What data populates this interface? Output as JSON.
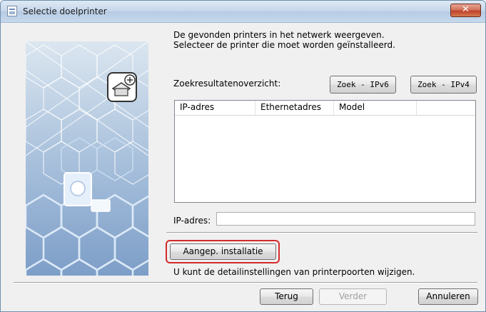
{
  "window": {
    "title": "Selectie doelprinter",
    "close_label": "✕"
  },
  "intro": {
    "line1": "De gevonden printers in het netwerk weergeven.",
    "line2": "Selecteer de printer die moet worden geïnstalleerd."
  },
  "search": {
    "label": "Zoekresultatenoverzicht:",
    "ipv6_button": "Zoek - IPv6",
    "ipv4_button": "Zoek - IPv4"
  },
  "results_table": {
    "columns": [
      "IP-adres",
      "Ethernetadres",
      "Model",
      ""
    ],
    "rows": []
  },
  "ip_field": {
    "label": "IP-adres:",
    "value": ""
  },
  "custom_install": {
    "button_label": "Aangep. installatie",
    "hint": "U kunt de detailinstellingen van printerpoorten wijzigen."
  },
  "footer": {
    "back_label": "Terug",
    "next_label": "Verder",
    "cancel_label": "Annuleren"
  },
  "colors": {
    "highlight": "#d42b2b",
    "close_button": "#c0412b"
  },
  "icons": [
    "window-app-icon",
    "close-icon",
    "network-printer-icon",
    "printer-illustration"
  ]
}
